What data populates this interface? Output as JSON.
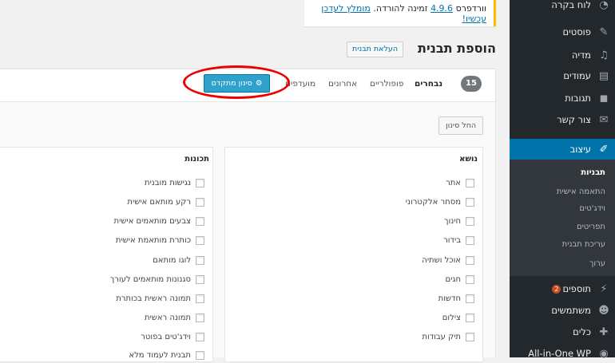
{
  "update_nag": {
    "part1": "וורדפרס",
    "version_link": "4.9.6",
    "part2": "זמינה להורדה.",
    "update_link": "מומלץ לעדכן עכשיו!"
  },
  "page": {
    "title": "הוספת תבנית",
    "upload_button": "העלאת תבנית"
  },
  "filters": {
    "count": "15",
    "tabs": [
      "נבחרים",
      "פופולריים",
      "אחרונים",
      "מועדפים"
    ],
    "advanced_button": "סינון מתקדם",
    "apply_button": "החל סינון"
  },
  "subject": {
    "heading": "נושא",
    "items": [
      "אתר",
      "מסחר אלקטרוני",
      "חינוך",
      "בידור",
      "אוכל ושתיה",
      "חגים",
      "חדשות",
      "צילום",
      "תיק עבודות"
    ]
  },
  "features": {
    "heading": "תכונות",
    "items": [
      "נגישות מובנית",
      "רקע מותאם אישית",
      "צבעים מותאמים אישית",
      "כותרת מותאמת אישית",
      "לוגו מותאם",
      "סגנונות מותאמים לעורך",
      "תמונה ראשית בכותרת",
      "תמונה ראשית",
      "וידג'טים בפוטר",
      "תבנית לעמוד מלא"
    ]
  },
  "sidebar": {
    "dashboard": "לוח בקרה",
    "posts": "פוסטים",
    "media": "מדיה",
    "pages": "עמודים",
    "comments": "תגובות",
    "contact": "צור קשר",
    "appearance": "עיצוב",
    "submenu": [
      "תבניות",
      "התאמה אישית",
      "וידג'טים",
      "תפריטים",
      "עריכת תבנית",
      "ערוך"
    ],
    "plugins": "תוספים",
    "plugins_badge": "2",
    "users": "משתמשים",
    "tools": "כלים",
    "aioseo": "All-in-One WP"
  },
  "colors": {
    "accent": "#0073aa",
    "button": "#2ea2cc",
    "highlight_ring": "#ee0000",
    "badge": "#ca4a1f"
  }
}
